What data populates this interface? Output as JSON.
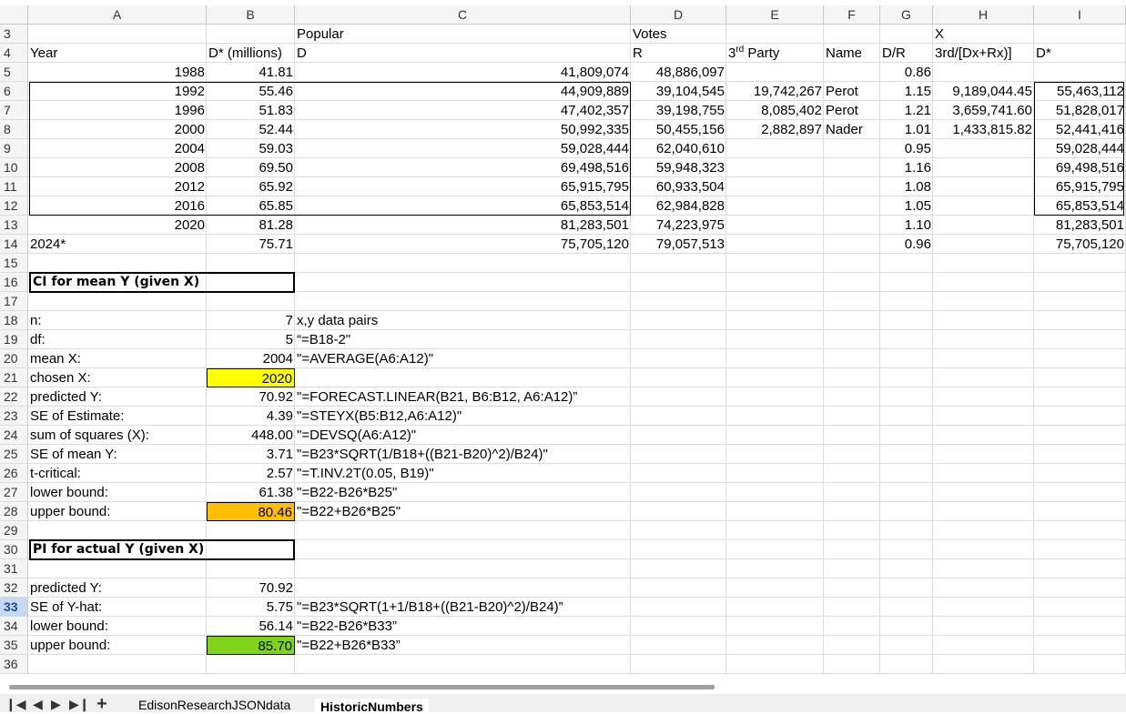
{
  "columns": [
    "A",
    "B",
    "C",
    "D",
    "E",
    "F",
    "G",
    "H",
    "I"
  ],
  "rows": [
    "3",
    "4",
    "5",
    "6",
    "7",
    "8",
    "9",
    "10",
    "11",
    "12",
    "13",
    "14",
    "15",
    "16",
    "17",
    "18",
    "19",
    "20",
    "21",
    "22",
    "23",
    "24",
    "25",
    "26",
    "27",
    "28",
    "29",
    "30",
    "31",
    "32",
    "33",
    "34",
    "35",
    "36"
  ],
  "active_row": "33",
  "header": {
    "popular": "Popular",
    "votes": "Votes",
    "x": "X",
    "year": "Year",
    "d_star_millions": "D* (millions)",
    "d": "D",
    "r": "R",
    "third_party_num": "3",
    "third_party_sup": "rd",
    "third_party_rest": " Party",
    "name": "Name",
    "dr": "D/R",
    "x_formula": "3rd/[Dx+Rx)]",
    "d_star": "D*"
  },
  "data_rows": [
    {
      "year": "1988",
      "b": "41.81",
      "d": "41,809,074",
      "r": "48,886,097",
      "e": "",
      "f": "",
      "g": "0.86",
      "h": "",
      "i": ""
    },
    {
      "year": "1992",
      "b": "55.46",
      "d": "44,909,889",
      "r": "39,104,545",
      "e": "19,742,267",
      "f": "Perot",
      "g": "1.15",
      "h": "9,189,044.45",
      "i": "55,463,112"
    },
    {
      "year": "1996",
      "b": "51.83",
      "d": "47,402,357",
      "r": "39,198,755",
      "e": "8,085,402",
      "f": "Perot",
      "g": "1.21",
      "h": "3,659,741.60",
      "i": "51,828,017"
    },
    {
      "year": "2000",
      "b": "52.44",
      "d": "50,992,335",
      "r": "50,455,156",
      "e": "2,882,897",
      "f": "Nader",
      "g": "1.01",
      "h": "1,433,815.82",
      "i": "52,441,416"
    },
    {
      "year": "2004",
      "b": "59.03",
      "d": "59,028,444",
      "r": "62,040,610",
      "e": "",
      "f": "",
      "g": "0.95",
      "h": "",
      "i": "59,028,444"
    },
    {
      "year": "2008",
      "b": "69.50",
      "d": "69,498,516",
      "r": "59,948,323",
      "e": "",
      "f": "",
      "g": "1.16",
      "h": "",
      "i": "69,498,516"
    },
    {
      "year": "2012",
      "b": "65.92",
      "d": "65,915,795",
      "r": "60,933,504",
      "e": "",
      "f": "",
      "g": "1.08",
      "h": "",
      "i": "65,915,795"
    },
    {
      "year": "2016",
      "b": "65.85",
      "d": "65,853,514",
      "r": "62,984,828",
      "e": "",
      "f": "",
      "g": "1.05",
      "h": "",
      "i": "65,853,514"
    },
    {
      "year": "2020",
      "b": "81.28",
      "d": "81,283,501",
      "r": "74,223,975",
      "e": "",
      "f": "",
      "g": "1.10",
      "h": "",
      "i": "81,283,501"
    },
    {
      "year": "2024*",
      "b": "75.71",
      "d": "75,705,120",
      "r": "79,057,513",
      "e": "",
      "f": "",
      "g": "0.96",
      "h": "",
      "i": "75,705,120"
    }
  ],
  "ci_section": {
    "title": "CI for mean Y (given X)",
    "rows": [
      {
        "label": "n:",
        "value": "7",
        "note": "x,y data pairs"
      },
      {
        "label": "df:",
        "value": "5",
        "note": "“=B18-2\""
      },
      {
        "label": "mean X:",
        "value": "2004",
        "note": "\"=AVERAGE(A6:A12)\""
      },
      {
        "label": "chosen X:",
        "value": "2020",
        "note": ""
      },
      {
        "label": "predicted Y:",
        "value": "70.92",
        "note": "\"=FORECAST.LINEAR(B21, B6:B12, A6:A12)”"
      },
      {
        "label": "SE of Estimate:",
        "value": "4.39",
        "note": "\"=STEYX(B5:B12,A6:A12)\""
      },
      {
        "label": "sum of squares (X):",
        "value": "448.00",
        "note": "\"=DEVSQ(A6:A12)\""
      },
      {
        "label": "SE of mean Y:",
        "value": "3.71",
        "note": "\"=B23*SQRT(1/B18+((B21-B20)^2)/B24)\""
      },
      {
        "label": "t-critical:",
        "value": "2.57",
        "note": "\"=T.INV.2T(0.05, B19)\""
      },
      {
        "label": "lower bound:",
        "value": "61.38",
        "note": "\"=B22-B26*B25\""
      },
      {
        "label": "upper bound:",
        "value": "80.46",
        "note": "\"=B22+B26*B25\""
      }
    ]
  },
  "pi_section": {
    "title": "PI for actual Y (given X)",
    "rows": [
      {
        "label": "predicted Y:",
        "value": "70.92",
        "note": ""
      },
      {
        "label": "SE of Y-hat:",
        "value": "5.75",
        "note": "\"=B23*SQRT(1+1/B18+((B21-B20)^2)/B24)”"
      },
      {
        "label": "lower bound:",
        "value": "56.14",
        "note": "\"=B22-B26*B33”"
      },
      {
        "label": "upper bound:",
        "value": "85.70",
        "note": "\"=B22+B26*B33”"
      }
    ]
  },
  "sheet_tabs": [
    "EdisonResearchJSONdata",
    "HistoricNumbers"
  ],
  "active_tab": "HistoricNumbers",
  "nav": {
    "first": "⏴",
    "prev": "◀",
    "next": "▶",
    "last": "▶|",
    "add": "+"
  },
  "colors": {
    "chosen_x": "#ffff00",
    "ci_upper": "#ffbf00",
    "pi_upper": "#81d41a"
  }
}
